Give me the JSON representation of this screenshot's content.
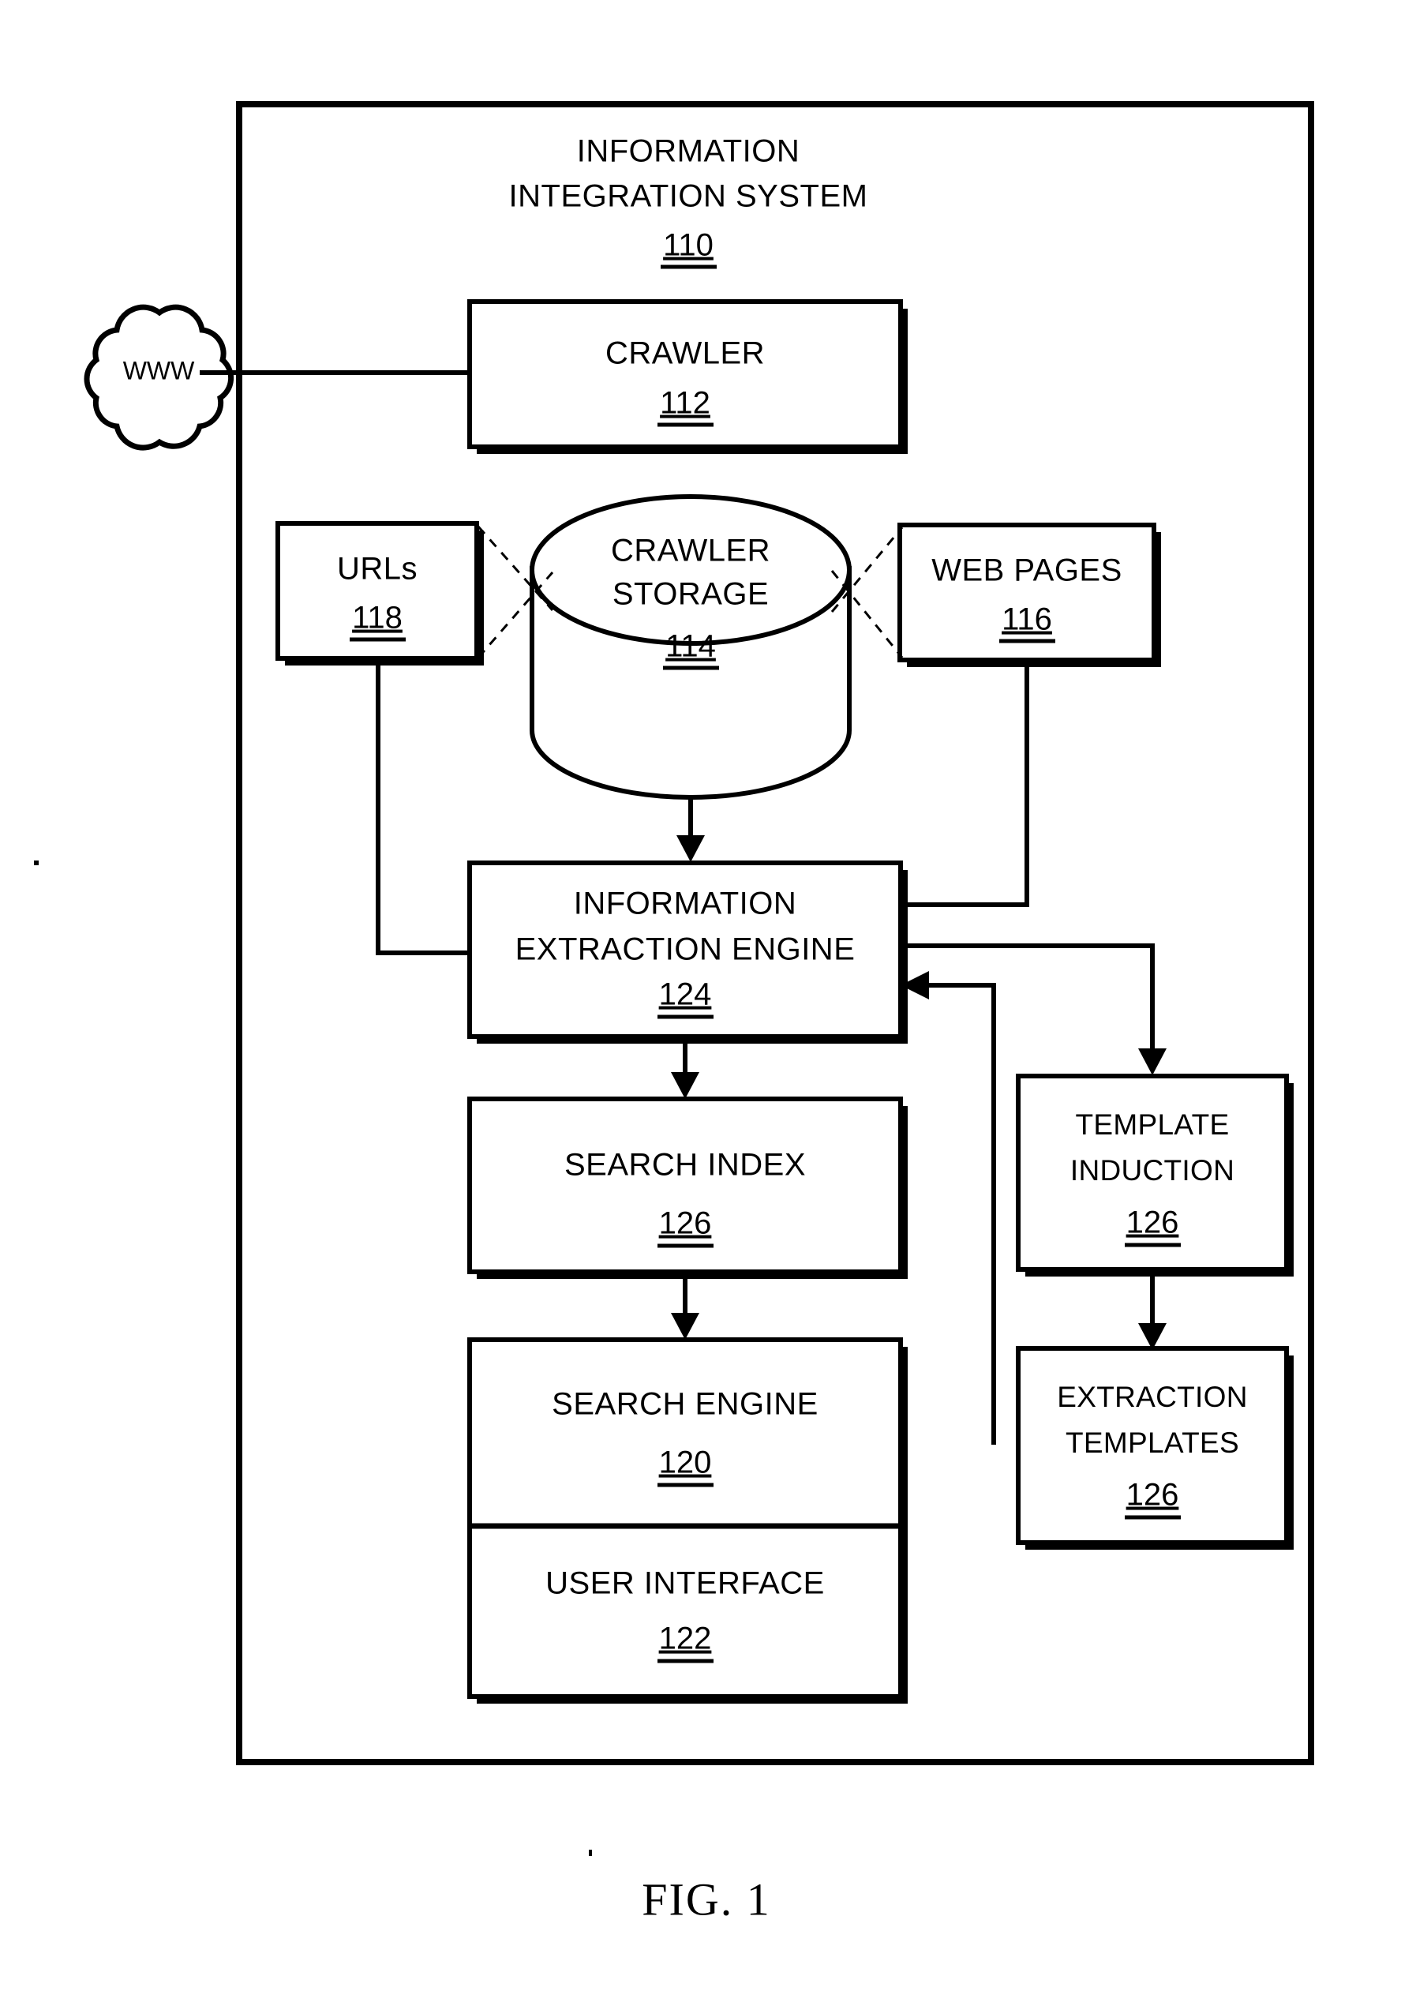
{
  "figure": {
    "caption": "FIG. 1",
    "system": {
      "title_line1": "INFORMATION",
      "title_line2": "INTEGRATION SYSTEM",
      "ref": "110"
    },
    "nodes": {
      "www": {
        "label": "WWW",
        "shape": "cloud"
      },
      "crawler": {
        "label": "CRAWLER",
        "ref": "112",
        "shape": "box"
      },
      "urls": {
        "label": "URLs",
        "ref": "118",
        "shape": "box"
      },
      "crawler_storage": {
        "label_line1": "CRAWLER",
        "label_line2": "STORAGE",
        "ref": "114",
        "shape": "cylinder"
      },
      "web_pages": {
        "label": "WEB PAGES",
        "ref": "116",
        "shape": "box"
      },
      "extraction_engine": {
        "label_line1": "INFORMATION",
        "label_line2": "EXTRACTION ENGINE",
        "ref": "124",
        "shape": "box"
      },
      "search_index": {
        "label": "SEARCH INDEX",
        "ref": "126",
        "shape": "box"
      },
      "search_engine": {
        "label": "SEARCH ENGINE",
        "ref": "120",
        "shape": "box"
      },
      "user_interface": {
        "label": "USER INTERFACE",
        "ref": "122",
        "shape": "box"
      },
      "template_induction": {
        "label_line1": "TEMPLATE",
        "label_line2": "INDUCTION",
        "ref": "126",
        "shape": "box"
      },
      "extraction_templates": {
        "label_line1": "EXTRACTION",
        "label_line2": "TEMPLATES",
        "ref": "126",
        "shape": "box"
      }
    },
    "edges": [
      {
        "from": "www",
        "to": "crawler",
        "style": "solid",
        "arrow": false
      },
      {
        "from": "urls",
        "to": "crawler_storage",
        "style": "dashed",
        "arrow": false
      },
      {
        "from": "web_pages",
        "to": "crawler_storage",
        "style": "dashed",
        "arrow": false
      },
      {
        "from": "crawler_storage",
        "to": "extraction_engine",
        "style": "solid",
        "arrow": true
      },
      {
        "from": "urls",
        "to": "extraction_engine",
        "style": "solid",
        "arrow": false
      },
      {
        "from": "web_pages",
        "to": "extraction_engine",
        "style": "solid",
        "arrow": false
      },
      {
        "from": "extraction_engine",
        "to": "search_index",
        "style": "solid",
        "arrow": true
      },
      {
        "from": "search_index",
        "to": "search_engine",
        "style": "solid",
        "arrow": true
      },
      {
        "from": "extraction_engine",
        "to": "template_induction",
        "style": "solid",
        "arrow": true
      },
      {
        "from": "template_induction",
        "to": "extraction_templates",
        "style": "solid",
        "arrow": true
      },
      {
        "from": "extraction_templates",
        "to": "extraction_engine",
        "style": "solid",
        "arrow": true
      }
    ],
    "colors": {
      "ink": "#000000",
      "paper": "#ffffff"
    }
  }
}
